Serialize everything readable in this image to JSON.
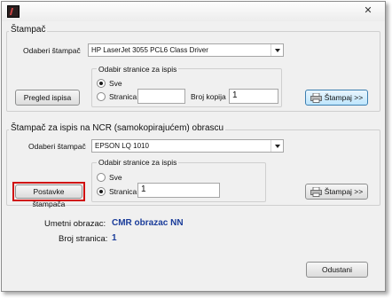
{
  "window": {
    "close_glyph": "✕",
    "icon": "app-icon"
  },
  "printer_section": {
    "title": "Štampač",
    "select_label": "Odaberi štampač",
    "printer_value": "HP LaserJet 3055 PCL6 Class Driver",
    "page_group_title": "Odabir stranice za ispis",
    "radio_all": "Sve",
    "radio_page": "Stranica",
    "page_value": "",
    "copies_label": "Broj kopija",
    "copies_value": "1",
    "preview_button": "Pregled ispisa",
    "print_button": "Štampaj >>"
  },
  "ncr_section": {
    "title": "Štampač za ispis na NCR (samokopirajućem) obrascu",
    "select_label": "Odaberi štampač",
    "printer_value": "EPSON LQ 1010",
    "page_group_title": "Odabir stranice za ispis",
    "radio_all": "Sve",
    "radio_page": "Stranica",
    "page_value": "1",
    "settings_button": "Postavke štampača",
    "print_button": "Štampaj >>"
  },
  "info": {
    "form_label": "Umetni obrazac:",
    "form_value": "CMR obrazac NN",
    "pages_label": "Broj stranica:",
    "pages_value": "1"
  },
  "cancel_button": "Odustani",
  "colors": {
    "highlight": "#d01010",
    "info_value": "#1a3c9a"
  }
}
